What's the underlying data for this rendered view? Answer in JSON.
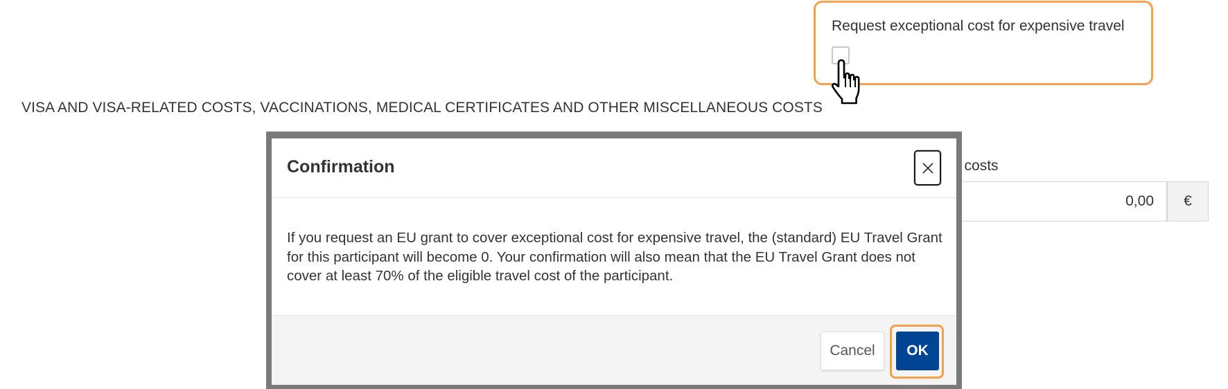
{
  "background": {
    "section_heading": "VISA AND VISA-RELATED COSTS, VACCINATIONS, MEDICAL CERTIFICATES AND OTHER MISCELLANEOUS COSTS",
    "exceptional_cost": {
      "label": "Request exceptional cost for expensive travel",
      "checked": false
    },
    "misc_costs": {
      "label_partial": "e costs",
      "value": "0,00",
      "currency": "€"
    }
  },
  "dialog": {
    "title": "Confirmation",
    "body": "If you request an EU grant to cover exceptional cost for expensive travel, the (standard) EU Travel Grant for this participant will become 0. Your confirmation will also mean that the EU Travel Grant does not cover at least 70% of the eligible travel cost of the participant.",
    "cancel_label": "Cancel",
    "ok_label": "OK"
  },
  "colors": {
    "highlight": "#f5a04a",
    "primary": "#004494",
    "overlay": "#7a7a7a"
  },
  "icons": {
    "close": "close-icon",
    "cursor": "hand-pointer-cursor"
  }
}
